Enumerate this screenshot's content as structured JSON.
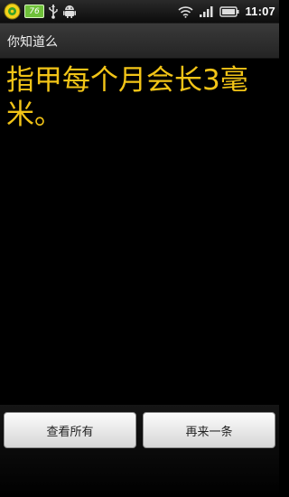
{
  "status_bar": {
    "battery_badge": "76",
    "time": "11:07",
    "icons": [
      "app-notification-icon",
      "battery-badge",
      "usb-icon",
      "android-icon",
      "wifi-icon",
      "signal-icon",
      "battery-icon"
    ]
  },
  "title_bar": {
    "title": "你知道么"
  },
  "main": {
    "fact": "指甲每个月会长3毫米。"
  },
  "buttons": {
    "view_all": "查看所有",
    "next": "再来一条"
  },
  "colors": {
    "fact_text": "#f2c417",
    "background": "#000000"
  }
}
